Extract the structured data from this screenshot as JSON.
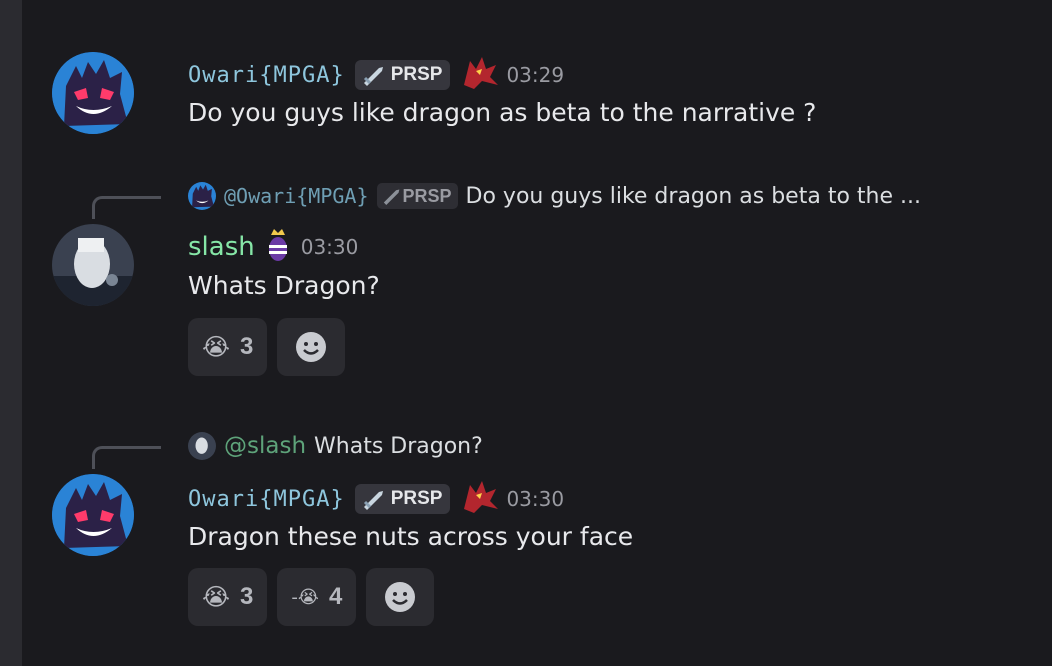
{
  "messages": [
    {
      "author": "Owari{MPGA}",
      "tag": "PRSP",
      "time": "03:29",
      "text": "Do you guys like dragon as beta to the narrative ?"
    },
    {
      "reply": {
        "mention": "@Owari{MPGA}",
        "tag": "PRSP",
        "excerpt": "Do you guys like dragon as beta to the ..."
      },
      "author": "slash",
      "time": "03:30",
      "text": "Whats Dragon?",
      "reactions": [
        {
          "emoji": "loudly-crying-face",
          "glyph": "😭",
          "count": "3"
        }
      ]
    },
    {
      "reply": {
        "mention": "@slash",
        "excerpt": "Whats Dragon?"
      },
      "author": "Owari{MPGA}",
      "tag": "PRSP",
      "time": "03:30",
      "text": "Dragon these nuts across your face",
      "reactions": [
        {
          "emoji": "loudly-crying-face",
          "glyph": "😭",
          "count": "3"
        },
        {
          "emoji": "custom-crying-emoji",
          "glyph": "-😭",
          "count": "4"
        }
      ]
    }
  ],
  "colors": {
    "background": "#1a1a1e",
    "owari_name": "#8ec6dd",
    "slash_name": "#86e6a7",
    "timestamp": "#9a9ba2"
  }
}
